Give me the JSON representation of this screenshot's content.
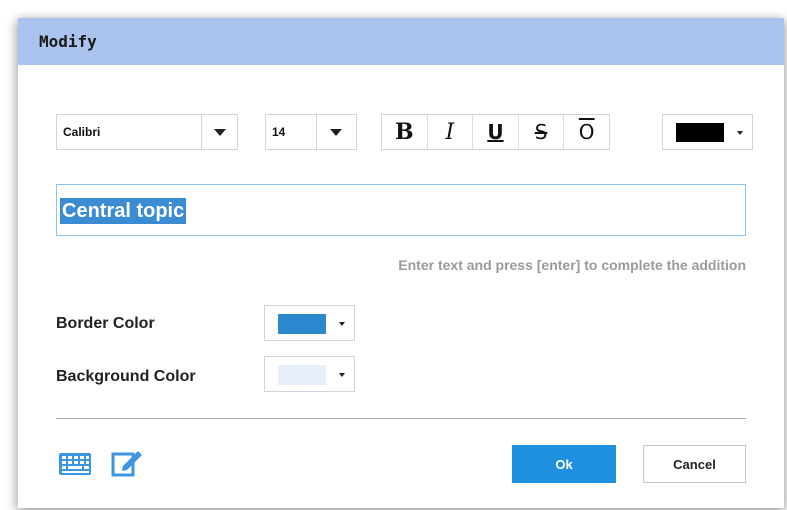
{
  "dialog": {
    "title": "Modify",
    "font_family": "Calibri",
    "font_size": "14",
    "format_buttons": [
      {
        "id": "bold",
        "glyph": "B"
      },
      {
        "id": "italic",
        "glyph": "I"
      },
      {
        "id": "underline",
        "glyph": "U"
      },
      {
        "id": "strikethrough",
        "glyph": "S"
      },
      {
        "id": "overline",
        "glyph": "O"
      }
    ],
    "text_color": "#000000",
    "text_value": "Central topic",
    "hint": "Enter text and press [enter] to complete the addition",
    "border_color_label": "Border Color",
    "border_color": "#2b88cf",
    "background_color_label": "Background Color",
    "background_color": "#e6eef8",
    "icons": [
      "keyboard-icon",
      "edit-icon"
    ],
    "ok_label": "Ok",
    "cancel_label": "Cancel"
  }
}
